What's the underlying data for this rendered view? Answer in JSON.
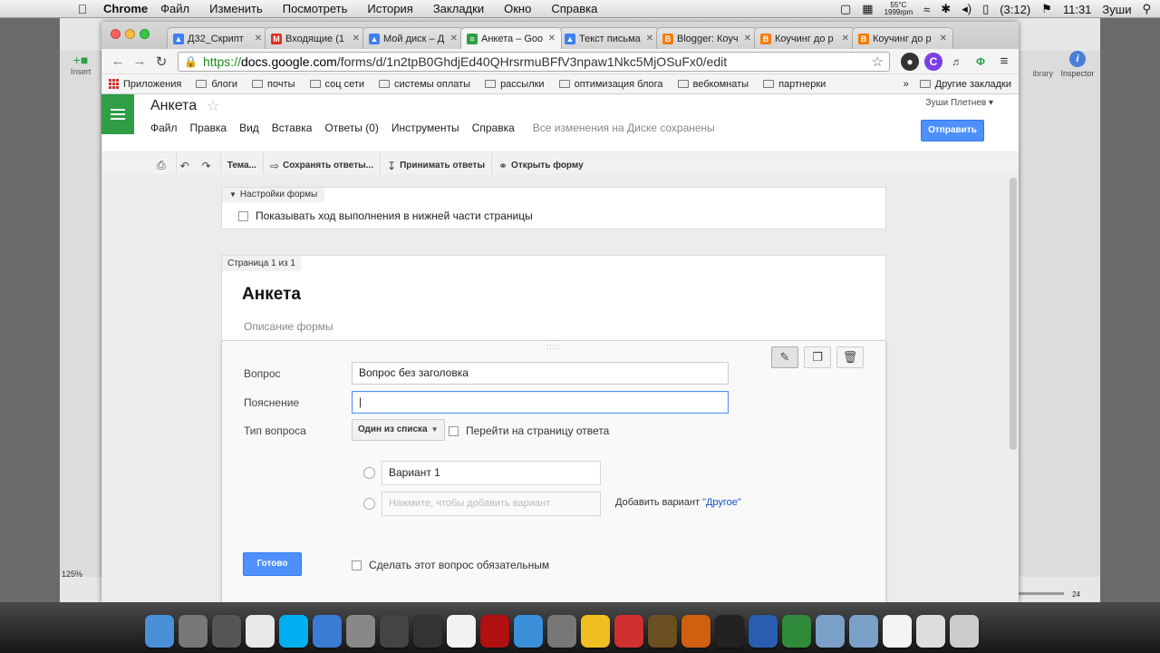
{
  "menubar": {
    "app_name": "Chrome",
    "menus": [
      "Файл",
      "Изменить",
      "Посмотреть",
      "История",
      "Закладки",
      "Окно",
      "Справка"
    ],
    "temp": "55°C",
    "fan": "1999rpm",
    "battery": "(3:12)",
    "time": "11:31",
    "user": "Зуши"
  },
  "bg_app": {
    "insert_label": "Insert",
    "library_label": "ibrary",
    "inspector_label": "Inspector",
    "zoom": "125%",
    "slider_value": "24"
  },
  "tabs": [
    {
      "title": "Д32_Скрипт",
      "color": "#3d7ef0",
      "glyph": "▲"
    },
    {
      "title": "Входящие (1",
      "color": "#d93025",
      "glyph": "M"
    },
    {
      "title": "Мой диск – Д",
      "color": "#3d7ef0",
      "glyph": "▲"
    },
    {
      "title": "Анкета – Goo",
      "color": "#2f9e44",
      "glyph": "≡",
      "active": true
    },
    {
      "title": "Текст письма",
      "color": "#3d7ef0",
      "glyph": "▲"
    },
    {
      "title": "Blogger: Коуч",
      "color": "#f57c00",
      "glyph": "B"
    },
    {
      "title": "Коучинг до р",
      "color": "#f57c00",
      "glyph": "B"
    },
    {
      "title": "Коучинг до р",
      "color": "#f57c00",
      "glyph": "B"
    }
  ],
  "address": {
    "scheme": "https://",
    "host": "docs.google.com",
    "path": "/forms/d/1n2tpB0GhdjEd40QHrsrmuBFfV3npaw1Nkc5MjOSuFx0/edit"
  },
  "bookmarks": {
    "apps_label": "Приложения",
    "items": [
      "блоги",
      "почты",
      "соц сети",
      "системы оплаты",
      "рассылки",
      "оптимизация блога",
      "вебкомнаты",
      "партнерки"
    ],
    "more": "»",
    "other": "Другие закладки"
  },
  "doc": {
    "title": "Анкета",
    "menu": [
      "Файл",
      "Правка",
      "Вид",
      "Вставка",
      "Ответы (0)",
      "Инструменты",
      "Справка"
    ],
    "save_status": "Все изменения на Диске сохранены",
    "user": "Зуши Плетнев",
    "send_label": "Отправить"
  },
  "form_tools": {
    "theme": "Тема...",
    "save_responses": "Сохранять ответы...",
    "accept_responses": "Принимать ответы",
    "open_form": "Открыть форму"
  },
  "settings": {
    "header": "Настройки формы",
    "progress_option": "Показывать ход выполнения в нижней части страницы"
  },
  "page": {
    "label": "Страница 1 из 1",
    "form_title": "Анкета",
    "form_description": "Описание формы"
  },
  "question": {
    "question_label": "Вопрос",
    "question_value": "Вопрос без заголовка",
    "help_label": "Пояснение",
    "help_value": "|",
    "type_label": "Тип вопроса",
    "type_value": "Один из списка",
    "goto_page": "Перейти на страницу ответа",
    "option1": "Вариант 1",
    "add_option_placeholder": "Нажмите, чтобы добавить вариант",
    "add_other_prefix": "Добавить вариант ",
    "add_other_link": "\"Другое\"",
    "done_label": "Готово",
    "required_label": "Сделать этот вопрос обязательным"
  },
  "dock_icons": [
    {
      "name": "finder",
      "color": "#4a90d9"
    },
    {
      "name": "launchpad",
      "color": "#777777"
    },
    {
      "name": "iphoto",
      "color": "#555555"
    },
    {
      "name": "chrome",
      "color": "#e8e8e8"
    },
    {
      "name": "skype",
      "color": "#00aff0"
    },
    {
      "name": "safari",
      "color": "#3a7bd5"
    },
    {
      "name": "preview",
      "color": "#888888"
    },
    {
      "name": "imovie",
      "color": "#444444"
    },
    {
      "name": "facetime",
      "color": "#333333"
    },
    {
      "name": "calendar",
      "color": "#f2f2f2"
    },
    {
      "name": "photobooth",
      "color": "#b01010"
    },
    {
      "name": "itunes",
      "color": "#3a8fd9"
    },
    {
      "name": "system-prefs",
      "color": "#777777"
    },
    {
      "name": "o-app",
      "color": "#f0c020"
    },
    {
      "name": "m-app",
      "color": "#d03030"
    },
    {
      "name": "photo-app",
      "color": "#6a5020"
    },
    {
      "name": "garageband",
      "color": "#d06010"
    },
    {
      "name": "dvd",
      "color": "#222222"
    },
    {
      "name": "word",
      "color": "#2a5db0"
    },
    {
      "name": "excel",
      "color": "#2f8a3a"
    },
    {
      "name": "folder-1",
      "color": "#7aa0c8"
    },
    {
      "name": "folder-2",
      "color": "#7aa0c8"
    },
    {
      "name": "document",
      "color": "#f4f4f4"
    },
    {
      "name": "screenshot",
      "color": "#dddddd"
    },
    {
      "name": "trash",
      "color": "#cccccc"
    }
  ],
  "colors": {
    "accent": "#4d90fe",
    "forms_green": "#2f9e44",
    "url_green": "#1a8a1a"
  }
}
